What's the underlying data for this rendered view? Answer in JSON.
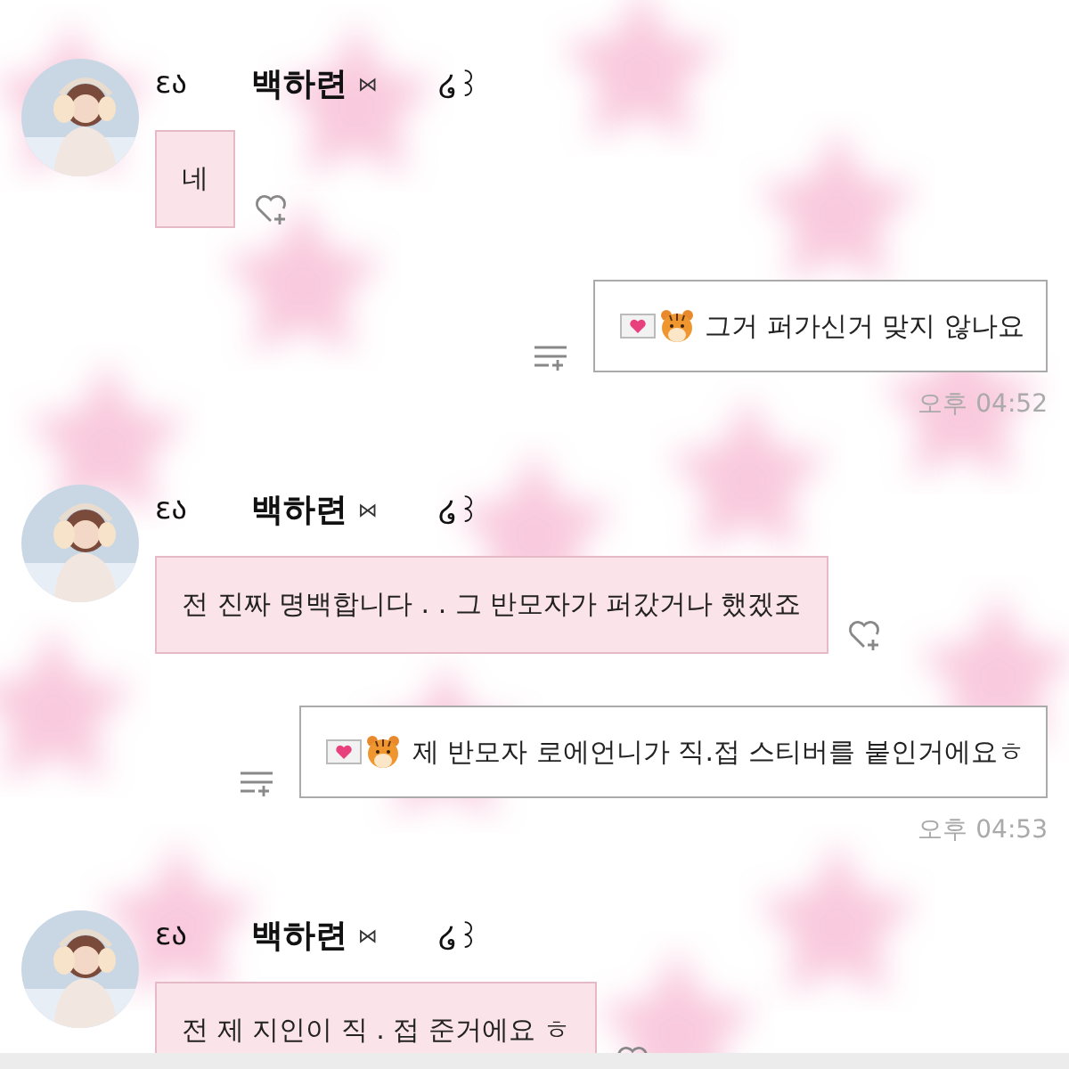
{
  "messages": [
    {
      "kind": "received",
      "name_left": "ɛა",
      "name": "백하련",
      "name_mid": "⋈",
      "name_right": "໒꒱",
      "text": "네"
    },
    {
      "kind": "sent",
      "text": "그거 퍼가신거 맞지 않나요",
      "time": "오후 04:52"
    },
    {
      "kind": "received",
      "name_left": "ɛა",
      "name": "백하련",
      "name_mid": "⋈",
      "name_right": "໒꒱",
      "text": "전 진짜 명백합니다 . . 그 반모자가 퍼갔거나 했겠죠"
    },
    {
      "kind": "sent",
      "text": "제 반모자 로에언니가 직.접 스티버를 붙인거에요ㅎ",
      "time": "오후 04:53"
    },
    {
      "kind": "received",
      "name_left": "ɛა",
      "name": "백하련",
      "name_mid": "⋈",
      "name_right": "໒꒱",
      "text": "전 제 지인이 직 . 접 준거에요 ㅎ"
    }
  ]
}
